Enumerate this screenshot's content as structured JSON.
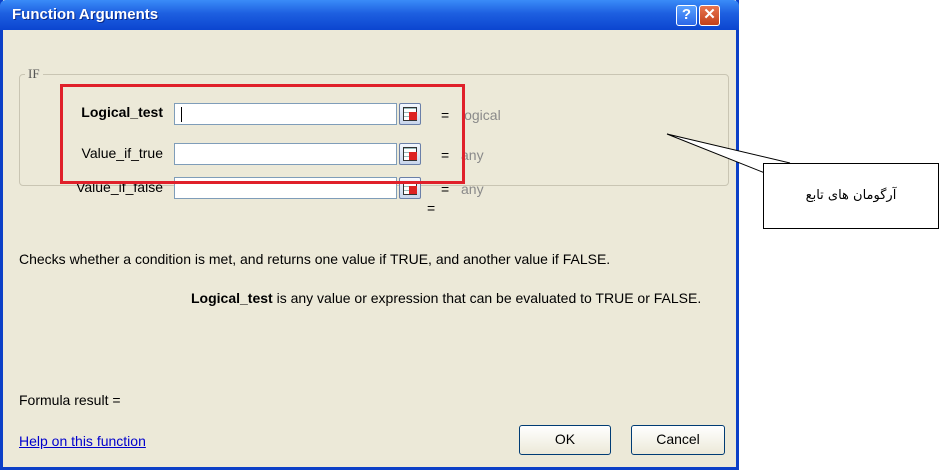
{
  "window": {
    "title": "Function Arguments",
    "help_label": "?",
    "close_label": "✕"
  },
  "function_name": "IF",
  "arguments": [
    {
      "label": "Logical_test",
      "value": "",
      "type": "logical",
      "bold": true
    },
    {
      "label": "Value_if_true",
      "value": "",
      "type": "any",
      "bold": false
    },
    {
      "label": "Value_if_false",
      "value": "",
      "type": "any",
      "bold": false
    }
  ],
  "equals_sign": "=",
  "result_equals": "=",
  "description": "Checks whether a condition is met, and returns one value if TRUE, and another value if FALSE.",
  "arg_description": {
    "name": "Logical_test",
    "text": "  is any value or expression that can be evaluated to TRUE or FALSE."
  },
  "formula_result": "Formula result =",
  "help_link": "Help on this function",
  "buttons": {
    "ok": "OK",
    "cancel": "Cancel"
  },
  "annotation": {
    "text": "آرگومان های تابع"
  },
  "colors": {
    "title_bar": "#1d5fe0",
    "highlight": "#e0202a",
    "dialog_bg": "#ece9d8",
    "link": "#0000cc"
  },
  "icons": {
    "ref_button": "collapse-dialog-icon"
  }
}
